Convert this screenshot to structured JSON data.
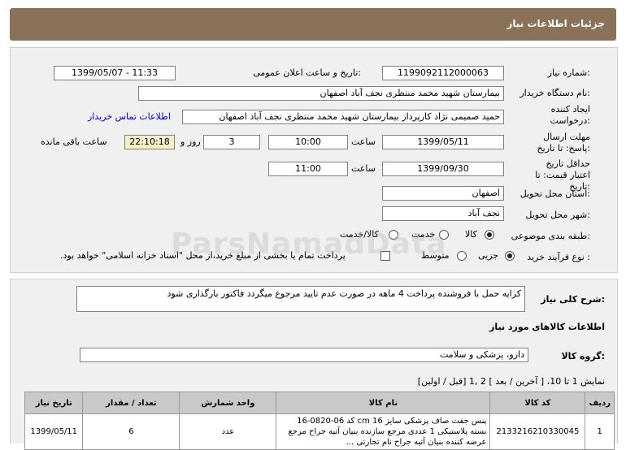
{
  "header": {
    "title": "جزئیات اطلاعات نیاز"
  },
  "form": {
    "need_number_label": "شماره نیاز:",
    "need_number": "1199092112000063",
    "announce_label": "تاریخ و ساعت اعلان عمومی:",
    "announce_value": "1399/05/07 - 11:33",
    "buyer_label": "نام دستگاه خریدار:",
    "buyer_value": "بیمارستان شهید محمد منتظری نجف آباد اصفهان",
    "creator_label": "ایجاد کننده درخواست:",
    "creator_value": "حمید صمیمی نژاد کارپرداز بیمارستان شهید محمد منتظری نجف آباد اصفهان",
    "contact_link": "اطلاعات تماس خریدار",
    "deadline_label": "مهلت ارسال پاسخ: تا تاریخ:",
    "deadline_date": "1399/05/11",
    "time_label": "ساعت",
    "deadline_time": "10:00",
    "days_value": "3",
    "days_label": "روز و",
    "remaining_time": "22:10:18",
    "remaining_label": "ساعت باقی مانده",
    "validity_label": "حداقل تاریخ اعتبار قیمت: تا تاریخ:",
    "validity_date": "1399/09/30",
    "validity_time": "11:00",
    "province_label": "استان محل تحویل:",
    "province_value": "اصفهان",
    "city_label": "شهر محل تحویل:",
    "city_value": "نجف آباد",
    "category_label": "طبقه بندی موضوعی:",
    "category_options": [
      "کالا",
      "خدمت",
      "کالا/خدمت"
    ],
    "category_selected": "کالا",
    "process_label": "نوع فرآیند خرید :",
    "process_options": [
      "جزیی",
      "متوسط"
    ],
    "process_selected": "جزیی",
    "payment_note": "پرداخت تمام یا بخشی از مبلغ خرید،از محل \"اسناد خزانه اسلامی\" خواهد بود."
  },
  "description": {
    "label": "شرح کلی نیاز:",
    "value": "کرایه حمل با فروشنده پرداخت 4 ماهه در صورت عدم تایید مرجوع میگردد فاکتور بارگذاری شود"
  },
  "goods": {
    "section_title": "اطلاعات کالاهای مورد نیاز",
    "group_label": "گروه کالا:",
    "group_value": "دارو، پزشکی و سلامت",
    "pagination": "نمایش 1 تا 10، [ آخرین / بعد ] 2 ,1 [قبل / اولین]",
    "columns": [
      "ردیف",
      "کد کالا",
      "نام کالا",
      "واحد شمارش",
      "تعداد / مقدار",
      "تاریخ نیاز"
    ],
    "rows": [
      {
        "index": "1",
        "code": "2133216210330045",
        "name": "پنس جفت صاف پزشکی سایز 16 cm کد 06-0820-16 بسته پلاستیکی 1 عددی مرجع سازنده بنیان آتیه جراح مرجع عرضه کننده بنیان آتیه جراح نام تجارتی ...",
        "unit": "عدد",
        "qty": "6",
        "date": "1399/05/11"
      }
    ]
  },
  "watermark": {
    "text": "ParsNamadData"
  },
  "colors": {
    "title_bar": "#8a7259",
    "panel": "#f0f0f0",
    "table_header": "#c9c9c9",
    "link": "#0000cc"
  }
}
